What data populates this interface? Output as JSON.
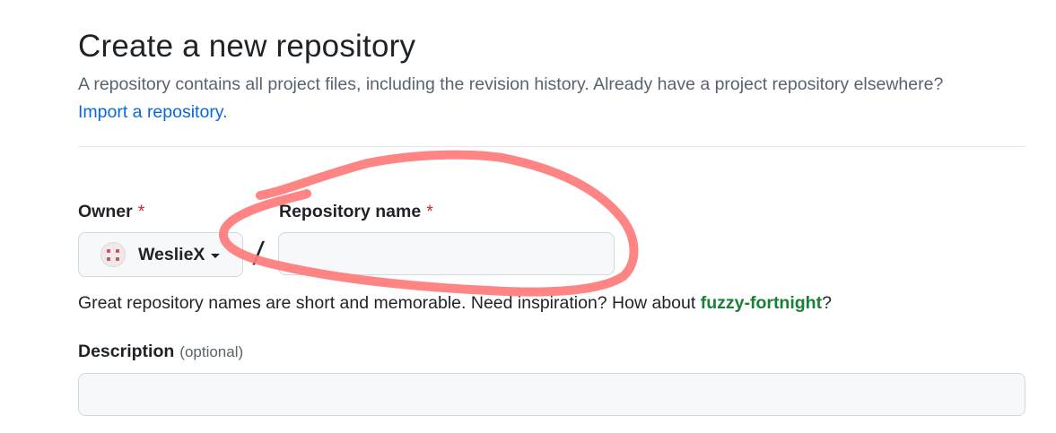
{
  "page": {
    "title": "Create a new repository",
    "subtitle": "A repository contains all project files, including the revision history. Already have a project repository elsewhere?",
    "import_link": "Import a repository."
  },
  "form": {
    "owner": {
      "label": "Owner",
      "required_mark": "*",
      "value": "WeslieX",
      "avatar_icon": "identicon-icon"
    },
    "separator": "/",
    "repository_name": {
      "label": "Repository name",
      "required_mark": "*",
      "value": "",
      "placeholder": ""
    },
    "name_hint": {
      "text": "Great repository names are short and memorable. Need inspiration? How about ",
      "suggestion": "fuzzy-fortnight",
      "suffix": "?"
    },
    "description": {
      "label": "Description",
      "optional_note": "(optional)",
      "value": "",
      "placeholder": ""
    }
  },
  "colors": {
    "link": "#0969da",
    "required": "#d1242f",
    "suggestion": "#1a7f37",
    "annotation_stroke": "#ff7b7b"
  }
}
